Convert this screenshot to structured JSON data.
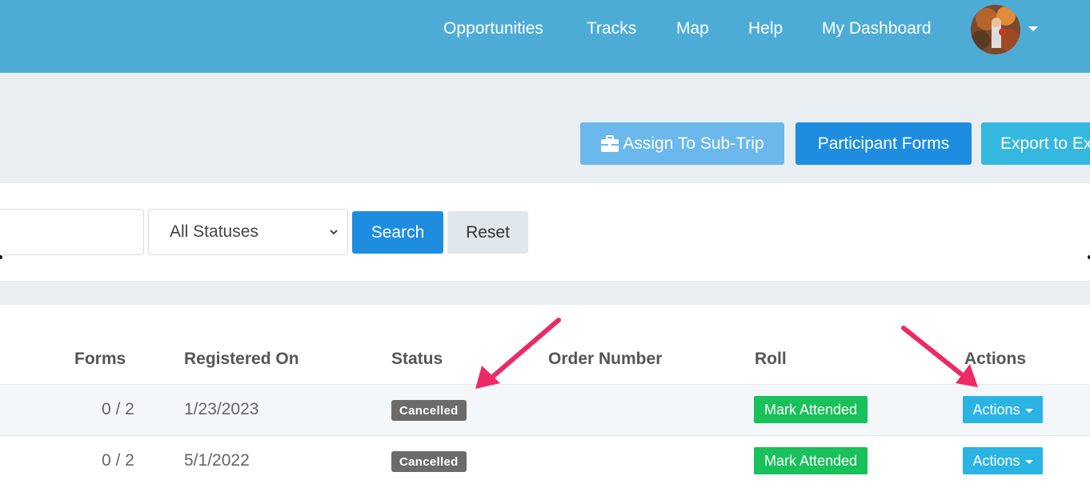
{
  "nav": {
    "links": [
      "Opportunities",
      "Tracks",
      "Map",
      "Help",
      "My Dashboard"
    ]
  },
  "toolbar": {
    "assign_label": "Assign To Sub-Trip",
    "forms_label": "Participant Forms",
    "export_label": "Export to Ex"
  },
  "filters": {
    "search_value": "",
    "status_selected": "All Statuses",
    "search_label": "Search",
    "reset_label": "Reset"
  },
  "table": {
    "headers": {
      "forms": "Forms",
      "registered_on": "Registered On",
      "status": "Status",
      "order_number": "Order Number",
      "roll": "Roll",
      "actions": "Actions"
    },
    "rows": [
      {
        "forms": "0 / 2",
        "registered_on": "1/23/2023",
        "status": "Cancelled",
        "order_number": "",
        "roll_label": "Mark Attended",
        "actions_label": "Actions"
      },
      {
        "forms": "0 / 2",
        "registered_on": "5/1/2022",
        "status": "Cancelled",
        "order_number": "",
        "roll_label": "Mark Attended",
        "actions_label": "Actions"
      }
    ]
  },
  "colors": {
    "nav_bg": "#4dacd6",
    "primary": "#1e8de0",
    "success": "#18c15a",
    "info": "#2bb3e3",
    "badge_gray": "#6b6b6b",
    "annotation_arrow": "#ee2a66"
  },
  "icons": {
    "avatar": "user-avatar",
    "assign": "briefcase-icon",
    "select": "chevron-down-icon",
    "dropdown": "caret-down-icon"
  }
}
